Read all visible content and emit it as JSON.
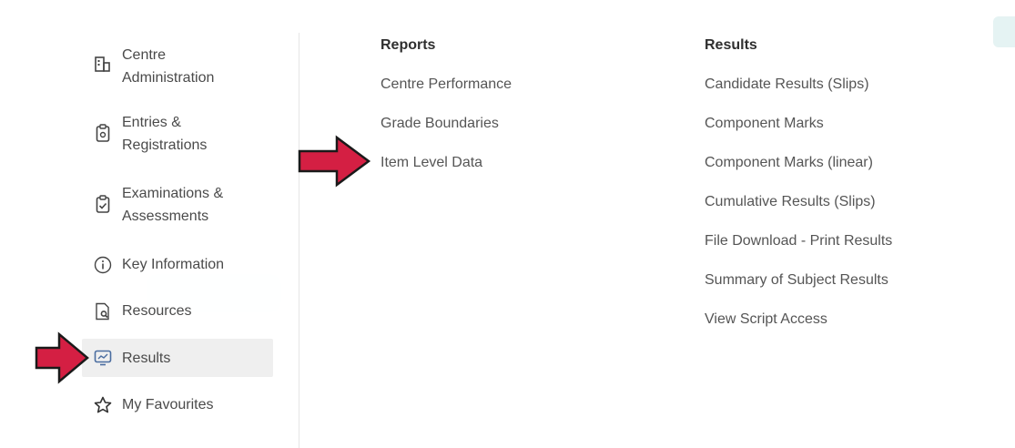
{
  "sidebar": {
    "items": [
      {
        "label": "Centre\nAdministration",
        "icon": "building-icon"
      },
      {
        "label": "Entries &\nRegistrations",
        "icon": "clipboard-icon"
      },
      {
        "label": "Examinations &\nAssessments",
        "icon": "clipboard-check-icon"
      },
      {
        "label": "Key Information",
        "icon": "info-icon"
      },
      {
        "label": "Resources",
        "icon": "document-search-icon"
      },
      {
        "label": "Results",
        "icon": "monitor-chart-icon",
        "active": true
      },
      {
        "label": "My Favourites",
        "icon": "star-icon"
      }
    ]
  },
  "reports": {
    "heading": "Reports",
    "links": [
      "Centre Performance",
      "Grade Boundaries",
      "Item Level Data"
    ]
  },
  "results": {
    "heading": "Results",
    "links": [
      "Candidate Results (Slips)",
      "Component Marks",
      "Component Marks (linear)",
      "Cumulative Results (Slips)",
      "File Download - Print Results",
      "Summary of Subject Results",
      "View Script Access"
    ]
  },
  "colors": {
    "annotation_arrow": "#d41f43",
    "active_bg": "#efefef",
    "text": "#555555"
  }
}
